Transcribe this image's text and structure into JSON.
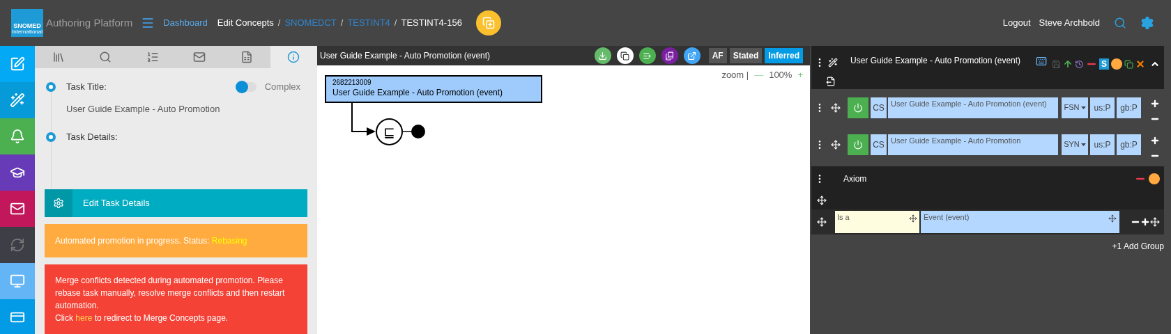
{
  "header": {
    "logo": {
      "line_1": "SNOMED",
      "line_2": "International"
    },
    "app_title": "Authoring Platform",
    "separator": "/",
    "breadcrumb": [
      {
        "label": "Dashboard",
        "kind": "home"
      },
      {
        "label": "Edit Concepts",
        "kind": "text"
      },
      {
        "label": "SNOMEDCT",
        "kind": "link"
      },
      {
        "label": "TESTINT4",
        "kind": "link"
      },
      {
        "label": "TESTINT4-156",
        "kind": "text"
      }
    ],
    "user_links": [
      "Logout",
      "Steve Archbold"
    ]
  },
  "side_nav": [
    {
      "kind": "edit",
      "color": "#03a9f4"
    },
    {
      "kind": "wand",
      "color": "#079ad8"
    },
    {
      "kind": "bell",
      "color": "#4caf50"
    },
    {
      "kind": "cap",
      "color": "#673ab7"
    },
    {
      "kind": "mail",
      "color": "#c2185b"
    },
    {
      "kind": "sync",
      "color": "#3d3e46"
    },
    {
      "kind": "monitor",
      "color": "#64b5f6"
    },
    {
      "kind": "card",
      "color": "#039be5"
    }
  ],
  "panel_tabs": [
    {
      "kind": "concepts",
      "selected": false
    },
    {
      "kind": "search",
      "selected": false
    },
    {
      "kind": "list",
      "selected": false
    },
    {
      "kind": "mail",
      "selected": false
    },
    {
      "kind": "excel",
      "selected": false
    },
    {
      "kind": "info",
      "selected": true
    }
  ],
  "task": {
    "title_label": "Task Title:",
    "title_value": "User Guide Example - Auto Promotion",
    "toggle": {
      "label": "Complex",
      "on": false
    },
    "details_label": "Task Details:"
  },
  "edit_button": "Edit Task Details",
  "alerts": [
    {
      "kind": "warning",
      "text": "Automated promotion in progress. Status: ",
      "status": "Rebasing"
    },
    {
      "kind": "error",
      "text": "Merge conflicts detected during automated promotion. Please rebase task manually, resolve merge conflicts and then restart automation.",
      "prefix": "Click ",
      "link": "here",
      "suffix": " to redirect to Merge Concepts page."
    }
  ],
  "diagram": {
    "title": "User Guide Example - Auto Promotion (event)",
    "actions": [
      {
        "kind": "download",
        "color": "#66bb6a"
      },
      {
        "kind": "copy",
        "color": "#ffffff"
      },
      {
        "kind": "add",
        "color": "#4caf50"
      },
      {
        "kind": "library",
        "color": "#7b1fa2"
      },
      {
        "kind": "open",
        "color": "#42a5f5"
      }
    ],
    "views": [
      {
        "label": "AF",
        "selected": false
      },
      {
        "label": "Stated",
        "selected": false
      },
      {
        "label": "Inferred",
        "selected": true
      }
    ],
    "zoom": {
      "label": "zoom |",
      "minus": "—",
      "value": "100%",
      "plus": "+"
    },
    "concept": {
      "id": "2682213009",
      "name": "User Guide Example - Auto Promotion (event)"
    },
    "node_symbol": "⊑"
  },
  "concept_editor": {
    "title": "User Guide Example - Auto Promotion (event)",
    "badge": "S",
    "descriptions": [
      {
        "active": true,
        "case": "CS",
        "term": "User Guide Example - Auto Promotion (event)",
        "type": "FSN",
        "us": "us:P",
        "gb": "gb:P"
      },
      {
        "active": true,
        "case": "CS",
        "term": "User Guide Example - Auto Promotion",
        "type": "SYN",
        "us": "us:P",
        "gb": "gb:P"
      }
    ],
    "axiom": {
      "title": "Axiom",
      "relationships": [
        {
          "type": "Is a",
          "target": "Event (event)"
        }
      ]
    },
    "add_group": "+1 Add Group"
  }
}
